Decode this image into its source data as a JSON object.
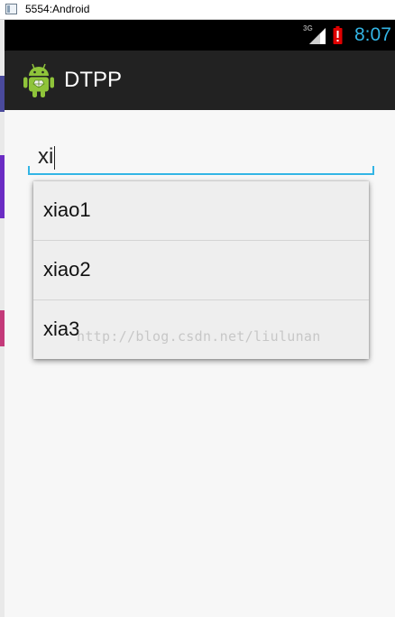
{
  "window": {
    "title": "5554:Android"
  },
  "status_bar": {
    "network": "3G",
    "time": "8:07",
    "colors": {
      "time": "#33b5e5",
      "battery_alert": "#e00000"
    },
    "icons": [
      "signal-icon",
      "battery-alert-icon"
    ]
  },
  "action_bar": {
    "title": "DTPP",
    "icon": "android-robot-icon"
  },
  "autocomplete": {
    "value": "xi",
    "suggestions": [
      {
        "label": "xiao1"
      },
      {
        "label": "xiao2"
      },
      {
        "label": "xia3"
      }
    ]
  },
  "watermark": "http://blog.csdn.net/liulunan",
  "colors": {
    "accent": "#33b5e5",
    "action_bar_bg": "#222222",
    "status_bar_bg": "#000000",
    "content_bg": "#f7f7f7",
    "dropdown_bg": "#eeeeee"
  }
}
